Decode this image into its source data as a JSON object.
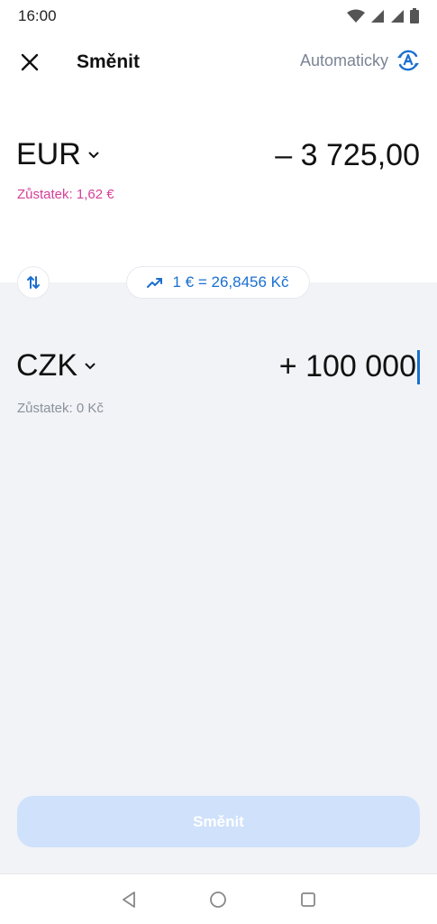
{
  "status_bar": {
    "time": "16:00",
    "icons": [
      "wifi-icon",
      "signal-icon",
      "signal-roaming-icon",
      "battery-icon"
    ]
  },
  "header": {
    "title": "Směnit",
    "auto_label": "Automaticky",
    "close_icon": "close-icon",
    "auto_icon": "auto-exchange-icon"
  },
  "from": {
    "currency": "EUR",
    "amount": "– 3 725,00",
    "balance": "Zůstatek: 1,62 €"
  },
  "rate": {
    "text": "1 € = 26,8456 Kč",
    "icon": "trending-up-icon"
  },
  "to": {
    "currency": "CZK",
    "amount": "+ 100 000",
    "balance": "Zůstatek: 0 Kč"
  },
  "submit": {
    "label": "Směnit"
  },
  "colors": {
    "accent": "#1a6fcf",
    "balance_warning": "#d63e99",
    "gray_bg": "#f1f3f6",
    "button_disabled": "#cfe1fb"
  }
}
